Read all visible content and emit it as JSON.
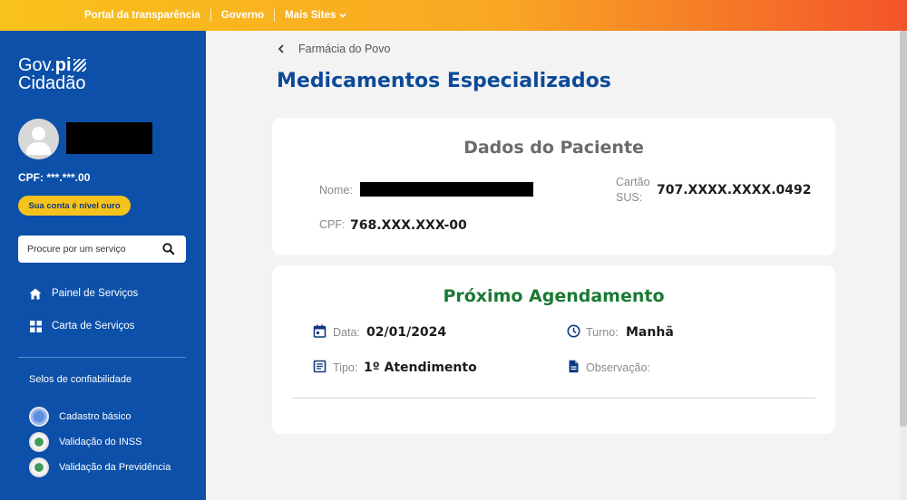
{
  "topbar": {
    "links": [
      "Portal da transparência",
      "Governo"
    ],
    "more_label": "Mais Sites"
  },
  "sidebar": {
    "logo_line1_a": "Gov.",
    "logo_line1_b": "pi",
    "logo_line2": "Cidadão",
    "cpf": "CPF: ***.***.00",
    "badge": "Sua conta é nível ouro",
    "search_placeholder": "Procure por um serviço",
    "nav": [
      {
        "label": "Painel de Serviços",
        "icon": "home-icon"
      },
      {
        "label": "Carta de Serviços",
        "icon": "grid-icon"
      }
    ],
    "selos_title": "Selos de confiabilidade",
    "selos": [
      {
        "label": "Cadastro básico",
        "icon": "seal-basic-icon"
      },
      {
        "label": "Validação do INSS",
        "icon": "seal-inss-icon"
      },
      {
        "label": "Validação da Previdência",
        "icon": "seal-previdencia-icon"
      }
    ]
  },
  "main": {
    "breadcrumb": "Farmácia do Povo",
    "title": "Medicamentos Especializados",
    "patient_card": {
      "title": "Dados do Paciente",
      "name_label": "Nome:",
      "sus_label_1": "Cartão",
      "sus_label_2": "SUS:",
      "sus_value": "707.XXXX.XXXX.0492",
      "cpf_label": "CPF:",
      "cpf_value": "768.XXX.XXX-00"
    },
    "schedule_card": {
      "title": "Próximo Agendamento",
      "date_label": "Data:",
      "date_value": "02/01/2024",
      "shift_label": "Turno:",
      "shift_value": "Manhã",
      "type_label": "Tipo:",
      "type_value": "1º Atendimento",
      "obs_label": "Observação:"
    }
  },
  "colors": {
    "sidebar": "#0c50a9",
    "title_blue": "#0c4a99",
    "schedule_green": "#1a7a33",
    "badge_gold": "#f6c21c"
  }
}
